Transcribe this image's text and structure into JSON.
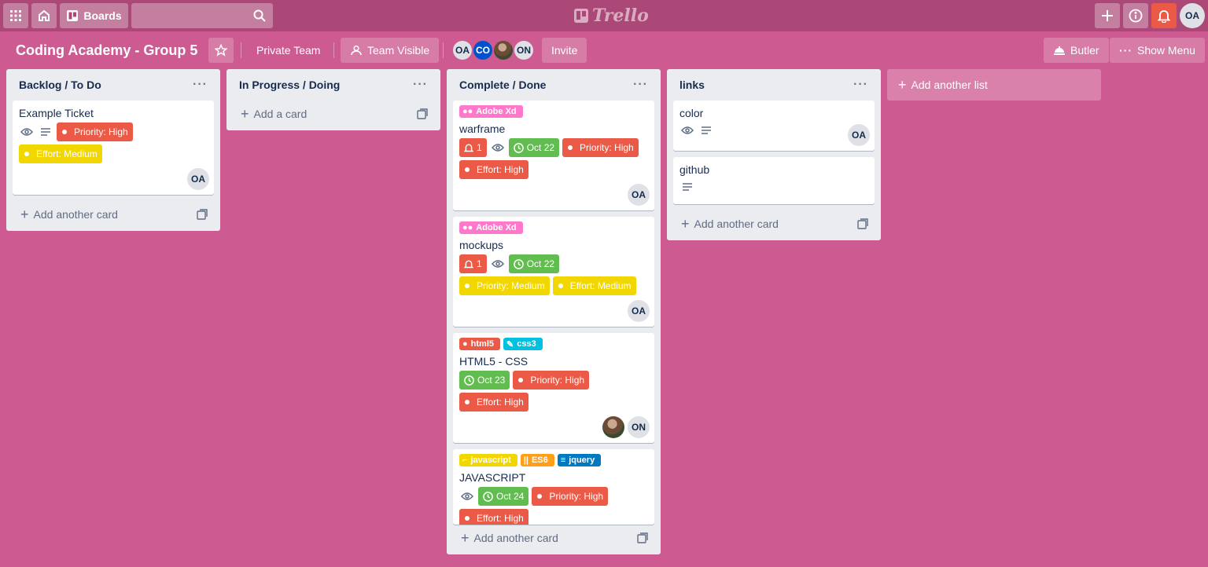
{
  "header": {
    "boards_label": "Boards",
    "logo_text": "Trello",
    "user_initials": "OA"
  },
  "board": {
    "title": "Coding Academy - Group 5",
    "team_label": "Private Team",
    "visibility_label": "Team Visible",
    "members": [
      "OA",
      "CO",
      "ON"
    ],
    "invite_label": "Invite",
    "butler_label": "Butler",
    "menu_label": "Show Menu"
  },
  "lists": [
    {
      "title": "Backlog / To Do",
      "add_card": "Add another card",
      "cards": [
        {
          "title": "Example Ticket",
          "labels": [
            "Priority: High",
            "Effort: Medium"
          ],
          "member": "OA"
        }
      ]
    },
    {
      "title": "In Progress / Doing",
      "add_card": "Add a card",
      "cards": []
    },
    {
      "title": "Complete / Done",
      "add_card": "Add another card",
      "cards": [
        {
          "title": "warframe",
          "tag": "Adobe Xd",
          "alerts": "1",
          "due": "Oct 22",
          "labels": [
            "Priority: High",
            "Effort: High"
          ],
          "member": "OA"
        },
        {
          "title": "mockups",
          "tag": "Adobe Xd",
          "alerts": "1",
          "due": "Oct 22",
          "labels": [
            "Priority: Medium",
            "Effort: Medium"
          ],
          "member": "OA"
        },
        {
          "title": "HTML5 - CSS",
          "tags": [
            "html5",
            "css3"
          ],
          "due": "Oct 23",
          "labels": [
            "Priority: High",
            "Effort: High"
          ],
          "member": "ON"
        },
        {
          "title": "JAVASCRIPT",
          "tags": [
            "javascript",
            "ES6",
            "jquery"
          ],
          "due": "Oct 24",
          "labels": [
            "Priority: High",
            "Effort: High"
          ]
        }
      ]
    },
    {
      "title": "links",
      "add_card": "Add another card",
      "cards": [
        {
          "title": "color",
          "member": "OA"
        },
        {
          "title": "github"
        }
      ]
    }
  ],
  "add_list_label": "Add another list",
  "colors": {
    "board_bg": "#cd5a91",
    "header_bg": "#ab4877",
    "label_red": "#eb5a46",
    "label_yellow": "#f2d600",
    "label_green": "#61bd4f",
    "label_pink": "#ff78cb",
    "label_sky": "#00c2e0",
    "label_orange": "#ff9f1a",
    "label_blue": "#0079bf",
    "notification_red": "#eb5a46"
  },
  "icons": [
    "apps-icon",
    "home-icon",
    "boards-icon",
    "search-icon",
    "plus-icon",
    "info-icon",
    "bell-icon",
    "star-icon",
    "team-visible-icon",
    "butler-icon",
    "more-icon",
    "eye-icon",
    "description-icon",
    "clock-icon",
    "template-icon",
    "pencil-icon"
  ]
}
